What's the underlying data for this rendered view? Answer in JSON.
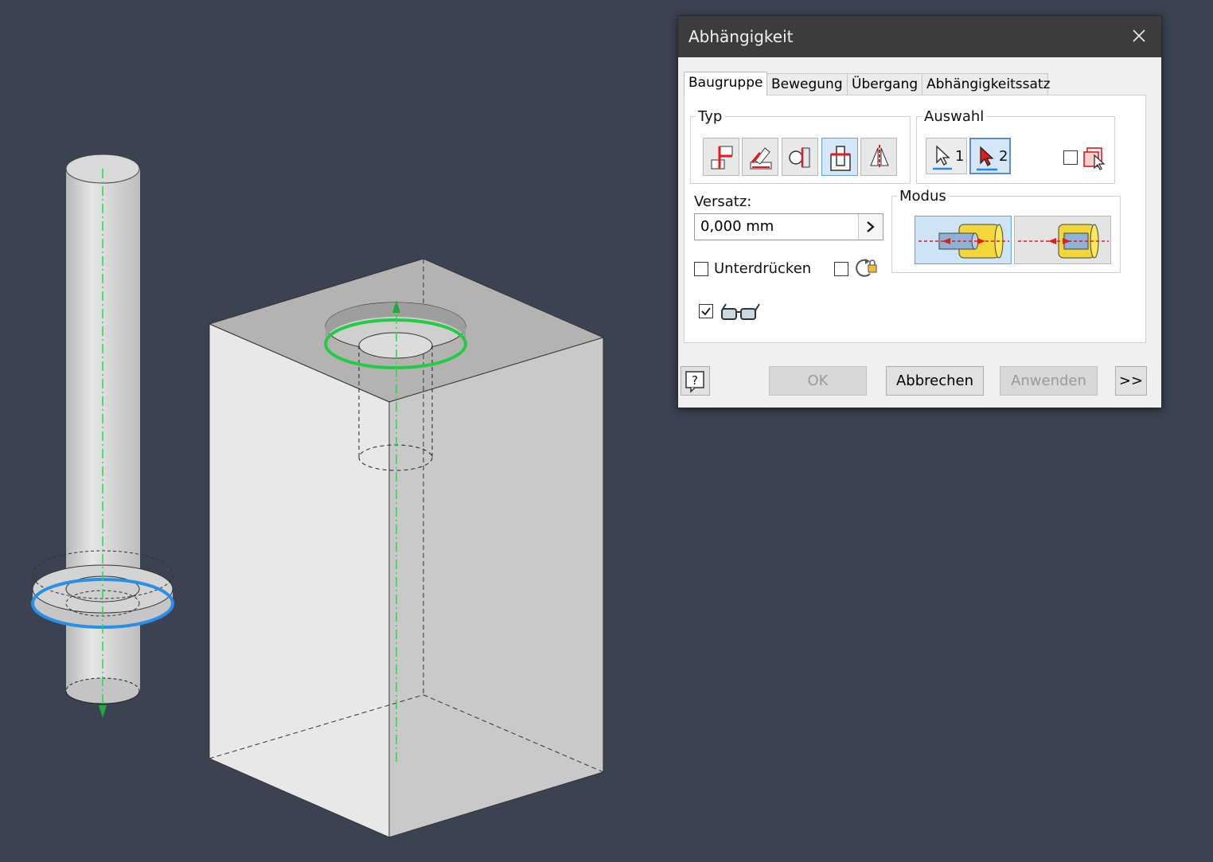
{
  "dialog": {
    "title": "Abhängigkeit",
    "tabs": [
      {
        "label": "Baugruppe",
        "active": true
      },
      {
        "label": "Bewegung",
        "active": false
      },
      {
        "label": "Übergang",
        "active": false
      },
      {
        "label": "Abhängigkeitssatz",
        "active": false
      }
    ],
    "type_group": {
      "label": "Typ",
      "buttons": [
        {
          "icon": "mate-constraint-icon",
          "active": false
        },
        {
          "icon": "angle-constraint-icon",
          "active": false
        },
        {
          "icon": "tangent-constraint-icon",
          "active": false
        },
        {
          "icon": "insert-constraint-icon",
          "active": true
        },
        {
          "icon": "symmetry-constraint-icon",
          "active": false
        }
      ]
    },
    "selection_group": {
      "label": "Auswahl",
      "select1_label": "1",
      "select2_label": "2",
      "pick_part_first_checked": false
    },
    "offset": {
      "label": "Versatz:",
      "value": "0,000 mm"
    },
    "mode_group": {
      "label": "Modus",
      "options": [
        {
          "icon": "opposed-solution-icon",
          "active": true
        },
        {
          "icon": "aligned-solution-icon",
          "active": false
        }
      ]
    },
    "suppress": {
      "label": "Unterdrücken",
      "checked": false
    },
    "predict_offset_checked": false,
    "show_preview_checked": true,
    "buttons": {
      "ok": "OK",
      "cancel": "Abbrechen",
      "apply": "Anwenden",
      "more": ">>"
    }
  },
  "colors": {
    "viewport_bg": "#3b4252",
    "axis_green": "#22dd44",
    "highlight_blue": "#2a8fe8",
    "highlight_green": "#22cc44"
  }
}
